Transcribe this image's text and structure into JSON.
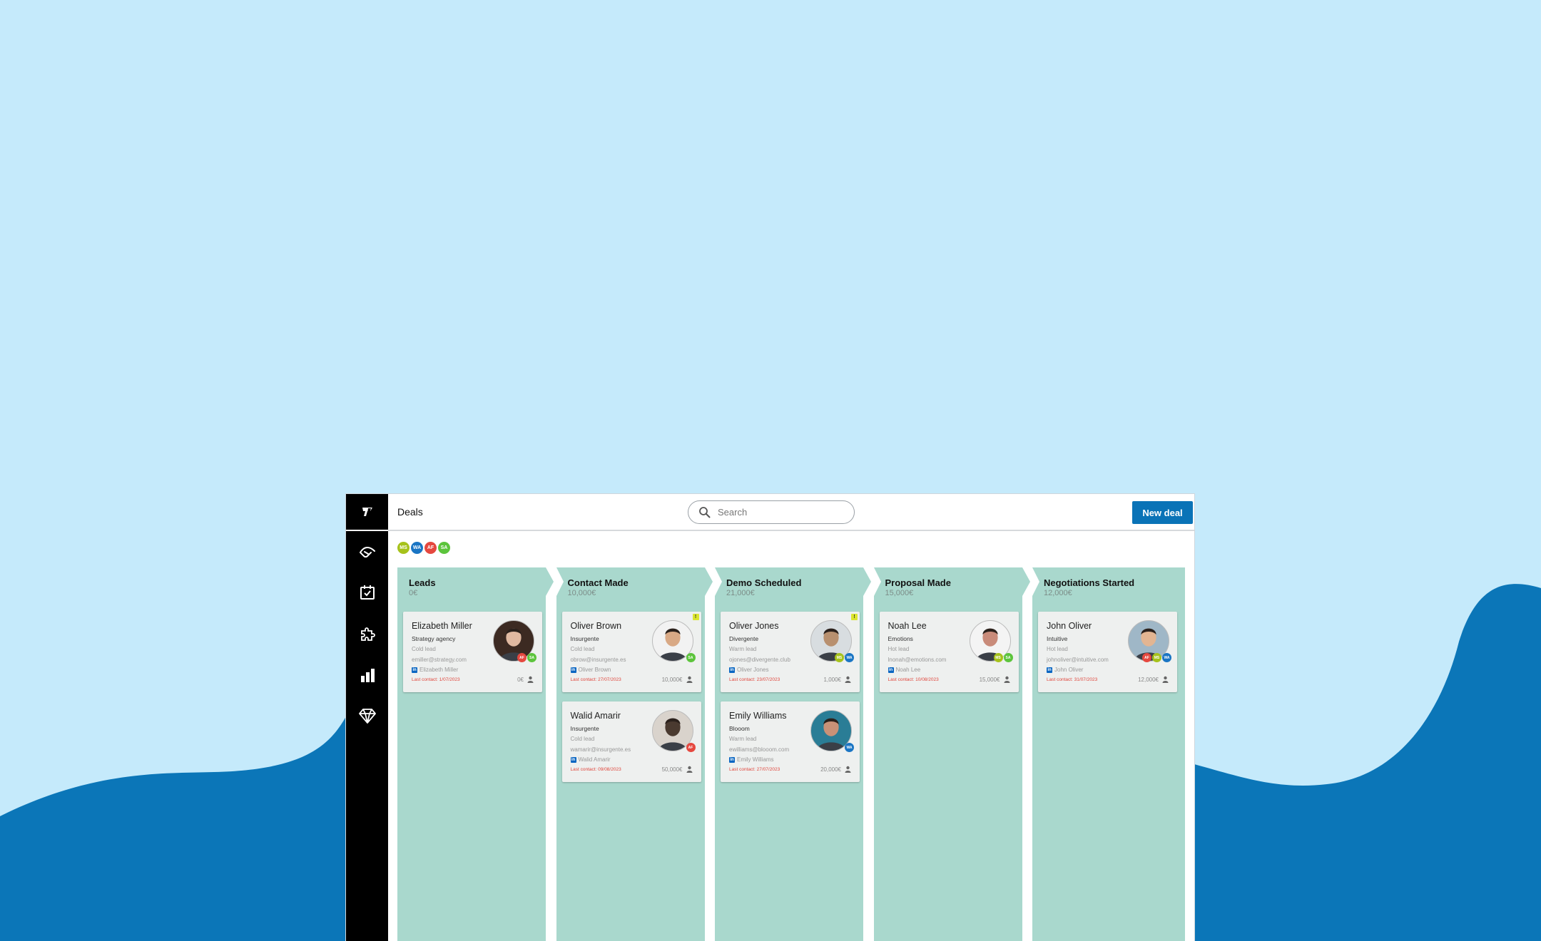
{
  "colors": {
    "background": "#c5eafb",
    "wave": "#0b76b8",
    "column": "#a9d8cd",
    "accent": "#0a73b7",
    "last_contact": "#e0453b"
  },
  "header": {
    "title": "Deals",
    "search_placeholder": "Search",
    "new_deal_label": "New deal"
  },
  "sidebar": {
    "items": [
      {
        "icon": "handshake-icon"
      },
      {
        "icon": "calendar-check-icon"
      },
      {
        "icon": "puzzle-icon"
      },
      {
        "icon": "bar-chart-icon"
      },
      {
        "icon": "diamond-icon"
      }
    ]
  },
  "filters": [
    {
      "initials": "MS",
      "color": "#a6c21b"
    },
    {
      "initials": "WA",
      "color": "#1a75c4"
    },
    {
      "initials": "AF",
      "color": "#e5483f"
    },
    {
      "initials": "SA",
      "color": "#5cc43c"
    }
  ],
  "columns": [
    {
      "title": "Leads",
      "total": "0€",
      "cards": [
        {
          "name": "Elizabeth Miller",
          "company": "Strategy agency",
          "lead": "Cold lead",
          "email": "emiller@strategy.com",
          "linkedin": "Elizabeth Miller",
          "last_contact": "Last contact: 1/07/2023",
          "amount": "0€",
          "alert": false,
          "avatar_bg": "#3c2a22",
          "avatar_skin": "#e0b9a1",
          "badges": [
            {
              "initials": "AF",
              "color": "#e5483f"
            },
            {
              "initials": "SA",
              "color": "#5cc43c"
            }
          ]
        }
      ]
    },
    {
      "title": "Contact Made",
      "total": "10,000€",
      "cards": [
        {
          "name": "Oliver Brown",
          "company": "Insurgente",
          "lead": "Cold lead",
          "email": "obrow@insurgente.es",
          "linkedin": "Oliver Brown",
          "last_contact": "Last contact: 27/07/2023",
          "amount": "10,000€",
          "alert": true,
          "avatar_bg": "#f2f2f2",
          "avatar_skin": "#d9a985",
          "badges": [
            {
              "initials": "SA",
              "color": "#5cc43c"
            }
          ]
        },
        {
          "name": "Walid Amarir",
          "company": "Insurgente",
          "lead": "Cold lead",
          "email": "wamarir@insurgente.es",
          "linkedin": "Walid Amarir",
          "last_contact": "Last contact: 09/08/2023",
          "amount": "50,000€",
          "alert": false,
          "avatar_bg": "#d9d3cc",
          "avatar_skin": "#4a3a30",
          "badges": [
            {
              "initials": "AF",
              "color": "#e5483f"
            }
          ]
        }
      ]
    },
    {
      "title": "Demo Scheduled",
      "total": "21,000€",
      "cards": [
        {
          "name": "Oliver Jones",
          "company": "Divergente",
          "lead": "Warm lead",
          "email": "ojones@divergente.club",
          "linkedin": "Oliver Jones",
          "last_contact": "Last contact: 23/07/2023",
          "amount": "1,000€",
          "alert": true,
          "avatar_bg": "#d8dde0",
          "avatar_skin": "#b8906f",
          "badges": [
            {
              "initials": "MS",
              "color": "#a6c21b"
            },
            {
              "initials": "WA",
              "color": "#1a75c4"
            }
          ]
        },
        {
          "name": "Emily Williams",
          "company": "Blooom",
          "lead": "Warm lead",
          "email": "ewilliams@blooom.com",
          "linkedin": "Emily Williams",
          "last_contact": "Last contact: 27/07/2023",
          "amount": "20,000€",
          "alert": false,
          "avatar_bg": "#2a7d96",
          "avatar_skin": "#c99177",
          "badges": [
            {
              "initials": "WA",
              "color": "#1a75c4"
            }
          ]
        }
      ]
    },
    {
      "title": "Proposal Made",
      "total": "15,000€",
      "cards": [
        {
          "name": "Noah Lee",
          "company": "Emotions",
          "lead": "Hot lead",
          "email": "lnonah@emotions.com",
          "linkedin": "Noah Lee",
          "last_contact": "Last contact: 10/08/2023",
          "amount": "15,000€",
          "alert": false,
          "avatar_bg": "#f4f4f4",
          "avatar_skin": "#c98b7a",
          "badges": [
            {
              "initials": "MS",
              "color": "#a6c21b"
            },
            {
              "initials": "SA",
              "color": "#5cc43c"
            }
          ]
        }
      ]
    },
    {
      "title": "Negotiations Started",
      "total": "12,000€",
      "cards": [
        {
          "name": "John Oliver",
          "company": "Intuitive",
          "lead": "Hot lead",
          "email": "johnoliver@intuitive.com",
          "linkedin": "John Oliver",
          "last_contact": "Last contact: 31/07/2023",
          "amount": "12,000€",
          "alert": false,
          "avatar_bg": "#9fb7c7",
          "avatar_skin": "#e2b592",
          "badges": [
            {
              "initials": "AF",
              "color": "#e5483f"
            },
            {
              "initials": "MS",
              "color": "#a6c21b"
            },
            {
              "initials": "WA",
              "color": "#1a75c4"
            }
          ]
        }
      ]
    }
  ]
}
